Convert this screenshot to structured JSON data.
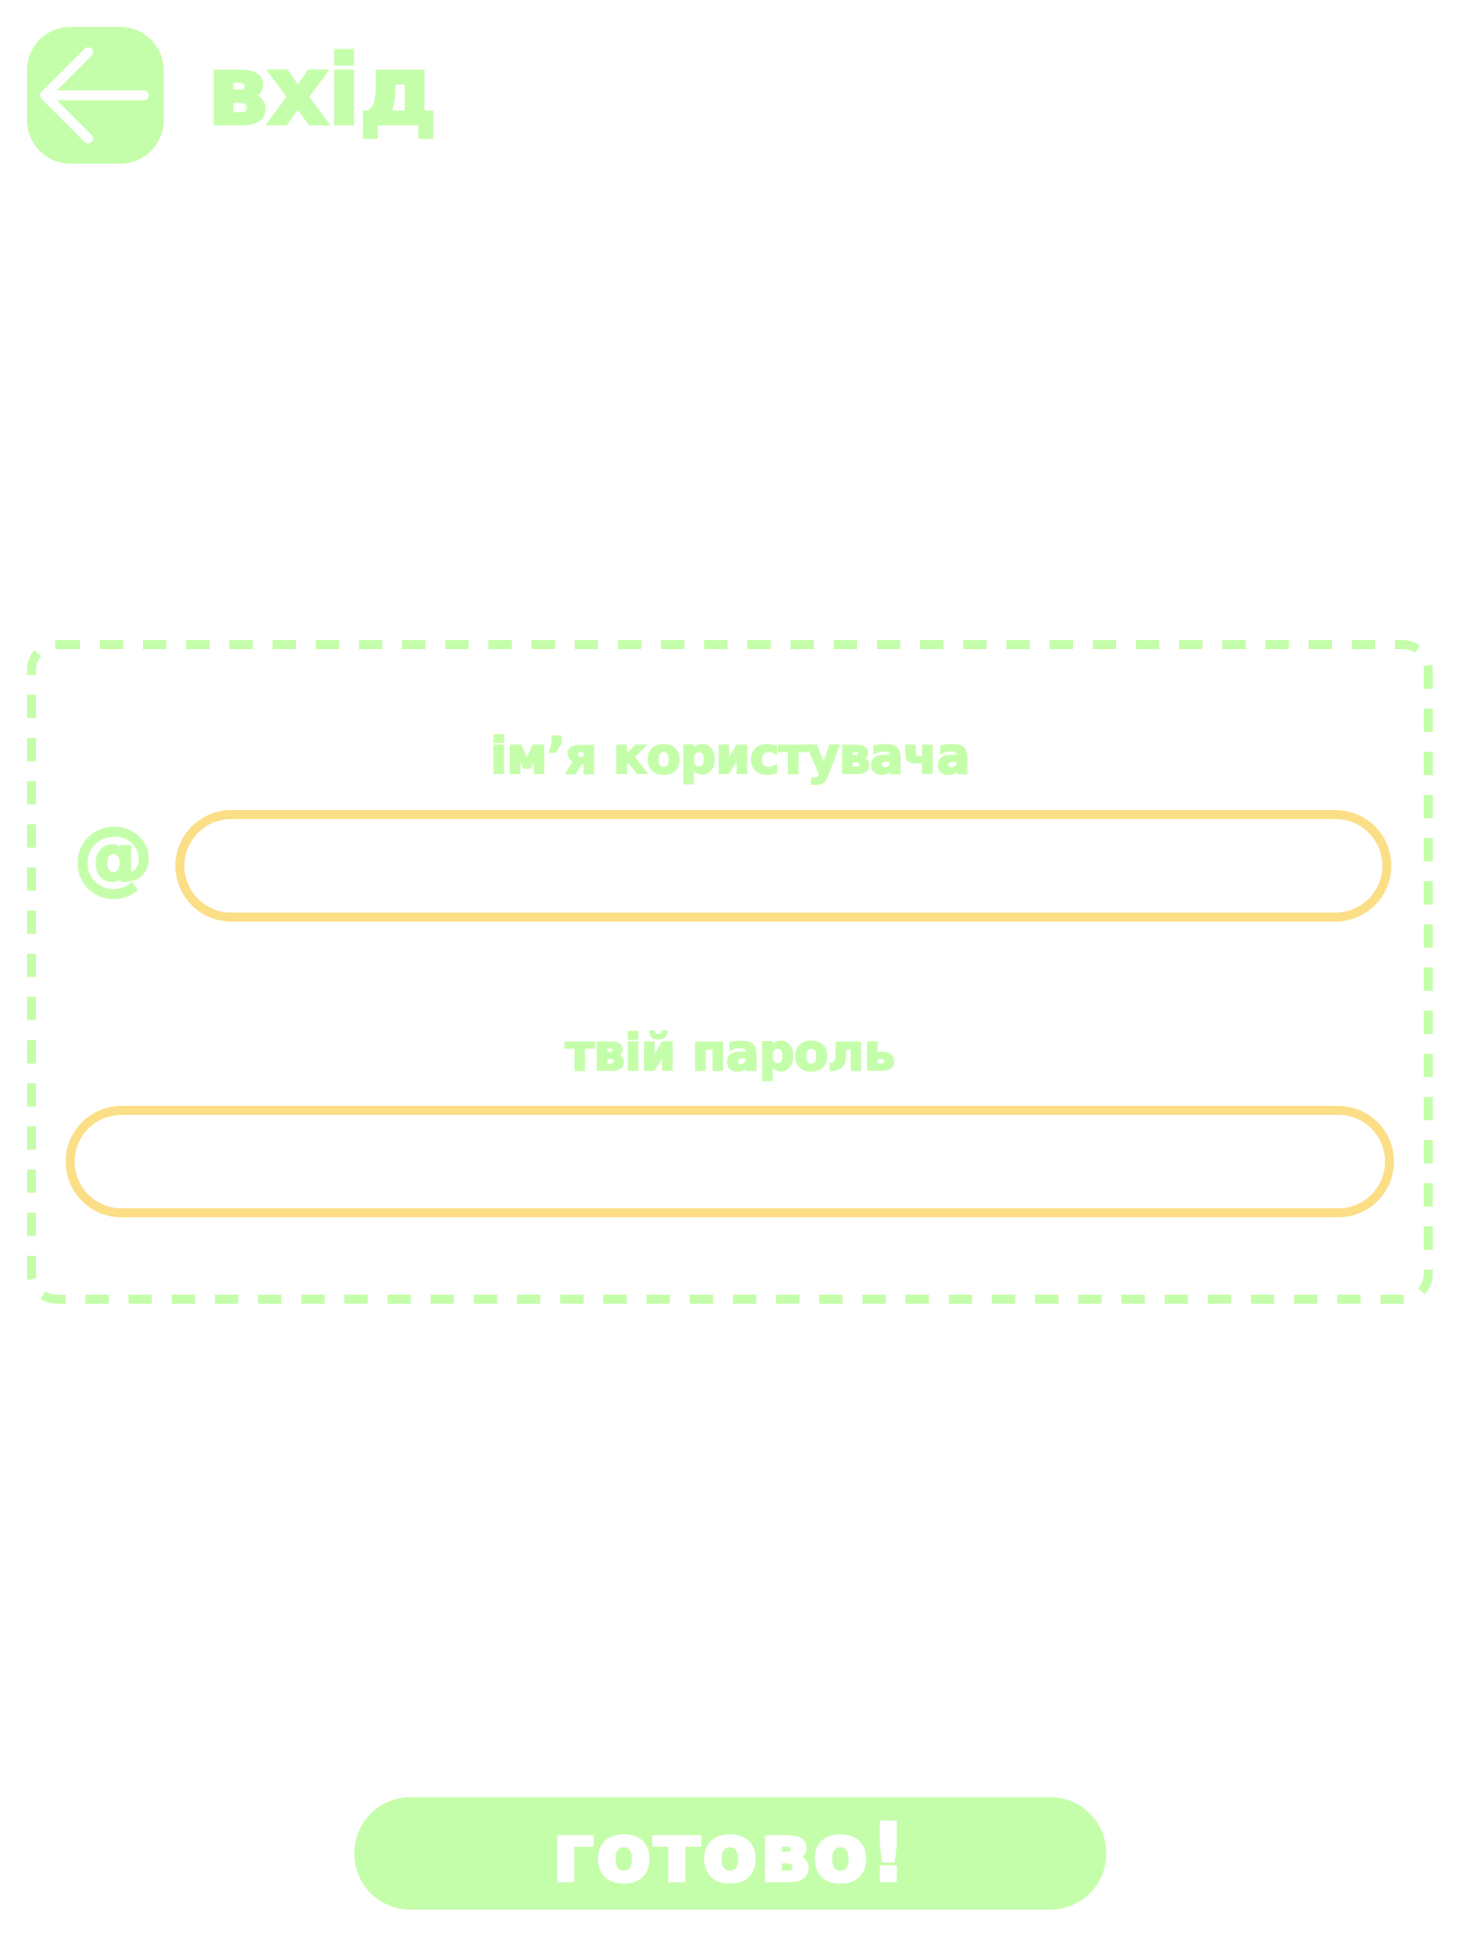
{
  "header": {
    "back_icon": "arrow-left-icon",
    "title": "вхід"
  },
  "form": {
    "username_label": "імʼя користувача",
    "username_prefix": "@",
    "username_prefix_icon": "at-sign-icon",
    "username_value": "",
    "password_label": "твій пароль",
    "password_value": ""
  },
  "footer": {
    "submit_label": "готово!"
  },
  "colors": {
    "accent": "#c5feaa",
    "input_border": "#fcde87",
    "background": "#ffffff",
    "button_text": "#ffffff"
  }
}
